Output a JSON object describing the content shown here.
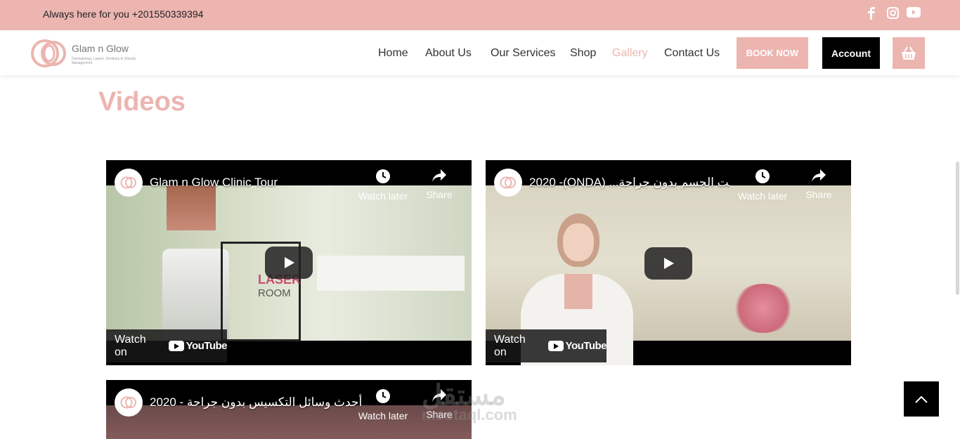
{
  "topbar": {
    "contact_text": "Always here for you +201550339394",
    "social": [
      "facebook-icon",
      "instagram-icon",
      "youtube-icon"
    ]
  },
  "header": {
    "logo": {
      "brand": "Glam n Glow",
      "tagline": "Dermatology, Lasers, Dentistry & Obesity Management"
    },
    "nav": [
      "Home",
      "About Us",
      "Our Services",
      "Shop",
      "Gallery",
      "Contact Us"
    ],
    "active_nav": "Gallery",
    "book_label": "BOOK NOW",
    "account_label": "Account"
  },
  "section": {
    "title": "Videos"
  },
  "videos": [
    {
      "title": "Glam n Glow Clinic Tour",
      "watch_later": "Watch later",
      "share": "Share",
      "watch_on": "Watch on",
      "overlay_1": "LASER",
      "overlay_2": "ROOM",
      "channel_logo_text": "Glam n Glow"
    },
    {
      "title": "2020 -(ONDA) ...از نحت الجسم بدون جراحة",
      "watch_later": "Watch later",
      "share": "Share",
      "watch_on": "Watch on",
      "channel_logo_text": "Glam n Glow"
    },
    {
      "title": "أحدث وسائل التكسيس بدون جراحة - 2020",
      "watch_later": "Watch later",
      "share": "Share",
      "channel_logo_text": "Glam n Glow"
    }
  ],
  "youtube_brand": "YouTube",
  "watermark": {
    "arabic": "مستقل",
    "latin": "mostaql.com"
  },
  "colors": {
    "accent": "#ecb5b0",
    "dark": "#000000"
  }
}
